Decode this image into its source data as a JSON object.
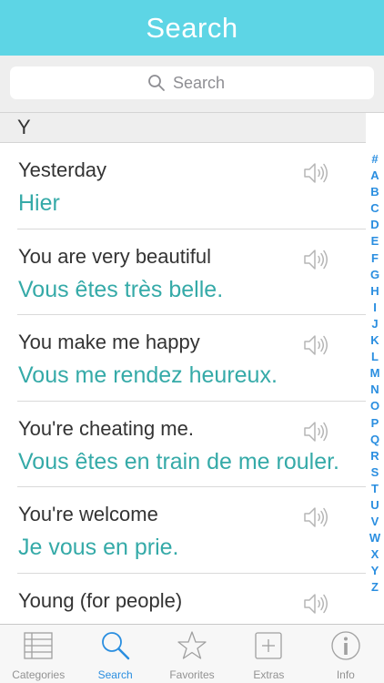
{
  "header": {
    "title": "Search"
  },
  "search": {
    "placeholder": "Search",
    "value": "",
    "icon": "search-icon"
  },
  "section": {
    "letter": "Y"
  },
  "phrases": [
    {
      "english": "Yesterday",
      "french": "Hier"
    },
    {
      "english": "You are very beautiful",
      "french": "Vous êtes très belle."
    },
    {
      "english": "You make me happy",
      "french": "Vous me rendez heureux."
    },
    {
      "english": "You're cheating me.",
      "french": "Vous êtes en train de me rouler."
    },
    {
      "english": "You're welcome",
      "french": "Je vous en prie."
    },
    {
      "english": "Young (for people)",
      "french": ""
    }
  ],
  "index_letters": [
    "#",
    "A",
    "B",
    "C",
    "D",
    "E",
    "F",
    "G",
    "H",
    "I",
    "J",
    "K",
    "L",
    "M",
    "N",
    "O",
    "P",
    "Q",
    "R",
    "S",
    "T",
    "U",
    "V",
    "W",
    "X",
    "Y",
    "Z"
  ],
  "tabs": [
    {
      "label": "Categories",
      "icon": "list-icon",
      "active": false
    },
    {
      "label": "Search",
      "icon": "search-icon",
      "active": true
    },
    {
      "label": "Favorites",
      "icon": "star-icon",
      "active": false
    },
    {
      "label": "Extras",
      "icon": "plus-icon",
      "active": false
    },
    {
      "label": "Info",
      "icon": "info-icon",
      "active": false
    }
  ],
  "colors": {
    "header": "#5dd5e5",
    "french_text": "#35aaa8",
    "accent": "#2a8ee0",
    "inactive_tab": "#929292"
  }
}
